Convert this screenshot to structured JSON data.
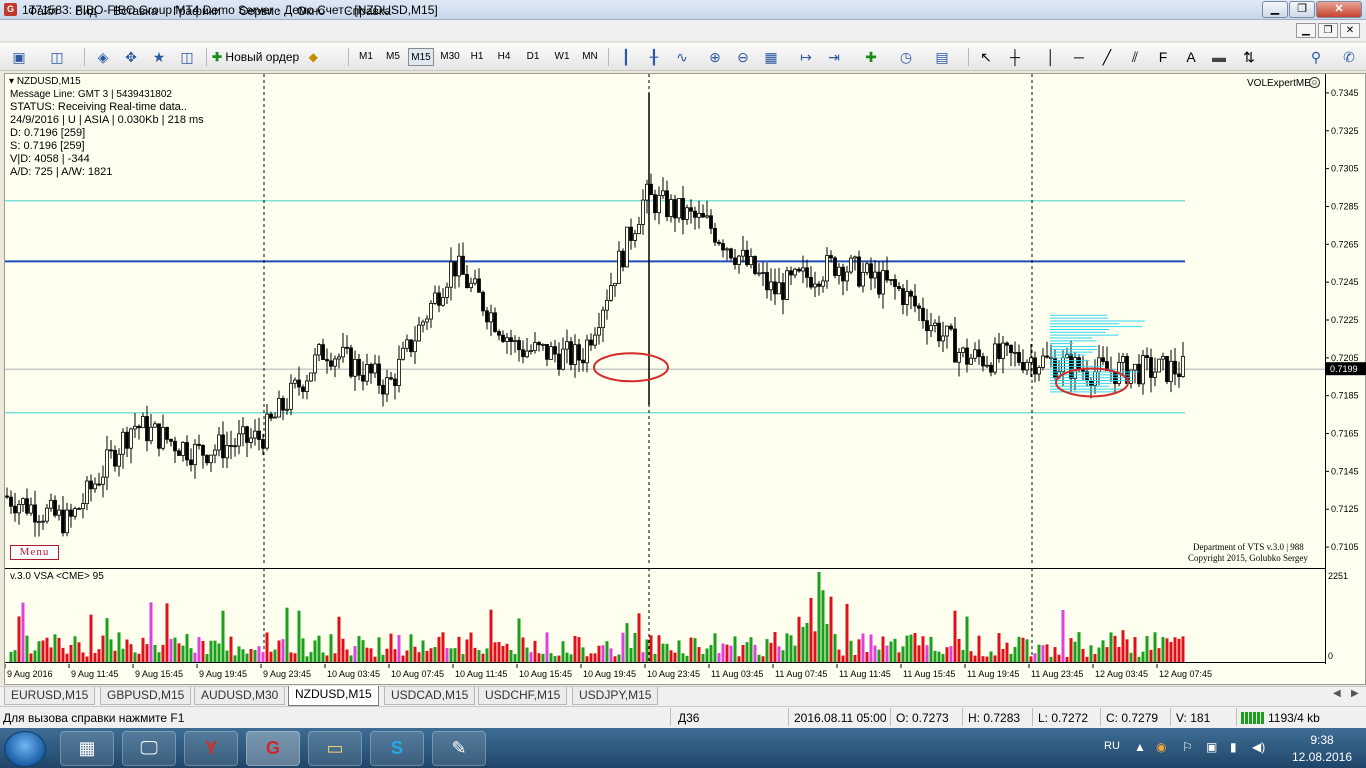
{
  "window": {
    "title": "1771583: FIBO-FIBO Group MT4 Demo Server - Демо Счет - [NZDUSD,M15]",
    "app_icon": "G",
    "min_glyph": "▁",
    "max_glyph": "❐",
    "close_glyph": "✕"
  },
  "menu": [
    "Файл",
    "Вид",
    "Вставка",
    "Графики",
    "Сервис",
    "Окно",
    "Справка"
  ],
  "mdi_controls": {
    "min": "▁",
    "restore": "❐",
    "close": "✕"
  },
  "toolbar": {
    "new_order_label": "Новый ордер",
    "timeframes": [
      "M1",
      "M5",
      "M15",
      "M30",
      "H1",
      "H4",
      "D1",
      "W1",
      "MN"
    ],
    "active_timeframe": "M15",
    "icons": {
      "new-chart": "▣",
      "profiles": "◫",
      "market-watch": "◈",
      "navigator": "✥",
      "favorites": "★",
      "expert": "◆",
      "bar-chart": "┃",
      "candle-chart": "╂",
      "line-chart": "∿",
      "zoom-in": "⊕",
      "zoom-out": "⊖",
      "tile": "▦",
      "autoscroll": "↦",
      "chart-shift": "⇥",
      "indicators": "✚",
      "periods": "◷",
      "templates": "▤",
      "cursor": "↖",
      "crosshair": "┼",
      "vline": "│",
      "hline": "─",
      "trendline": "╱",
      "channel": "⫽",
      "fibo": "F",
      "text": "A",
      "label": "▬",
      "arrows": "⇅",
      "search": "⚲",
      "community": "✆"
    }
  },
  "chart": {
    "symbol_label": "NZDUSD,M15",
    "info_lines": [
      "Message Line: GMT 3 | 5439431802",
      "STATUS:  Receiving Real-time data..",
      "24/9/2016 | U | ASIA | 0.030Kb | 218 ms",
      "D: 0.7196  [259]",
      "S: 0.7196  [259]",
      "V|D: 4058 | -344",
      "A/D: 725 | A/W: 1821"
    ],
    "menu_button": "Menu",
    "expert_label": "VOLExpertME",
    "expert_smile": "☺",
    "copyright_line1": "Department of VTS  v.3.0 | 988",
    "copyright_line2": "Copyright 2015, Golubko Sergey",
    "current_price": "0.7199",
    "price_levels": [
      "0.7345",
      "0.7325",
      "0.7305",
      "0.7285",
      "0.7265",
      "0.7245",
      "0.7225",
      "0.7205",
      "0.7185",
      "0.7165",
      "0.7145",
      "0.7125",
      "0.7105"
    ],
    "vsa_label": "v.3.0 VSA <CME> 95",
    "vol_max": "2251",
    "vol_zero": "0",
    "time_labels": [
      "9 Aug 2016",
      "9 Aug 11:45",
      "9 Aug 15:45",
      "9 Aug 19:45",
      "9 Aug 23:45",
      "10 Aug 03:45",
      "10 Aug 07:45",
      "10 Aug 11:45",
      "10 Aug 15:45",
      "10 Aug 19:45",
      "10 Aug 23:45",
      "11 Aug 03:45",
      "11 Aug 07:45",
      "11 Aug 11:45",
      "11 Aug 15:45",
      "11 Aug 19:45",
      "11 Aug 23:45",
      "12 Aug 03:45",
      "12 Aug 07:45"
    ],
    "colors": {
      "background": "#fffff0",
      "candle": "#000000",
      "resistance_line": "#1f4fbf",
      "level_line": "#7fe0d8",
      "circle": "#d42a2a",
      "volume_green": "#1aa01a",
      "volume_red": "#e0101a",
      "volume_magenta": "#e040e0",
      "profile": "#33d6f0"
    }
  },
  "chart_data": {
    "type": "candlestick",
    "symbol": "NZDUSD",
    "timeframe": "M15",
    "ylim": [
      0.7095,
      0.7355
    ],
    "horizontal_levels": [
      0.7288,
      0.7256,
      0.7199,
      0.7176
    ],
    "key_points": [
      {
        "t": "9 Aug 2016",
        "price": 0.7132
      },
      {
        "t": "9 Aug 11:45",
        "price": 0.7118
      },
      {
        "t": "9 Aug 15:45",
        "price": 0.717
      },
      {
        "t": "9 Aug 19:45",
        "price": 0.7155
      },
      {
        "t": "9 Aug 23:45",
        "price": 0.7163
      },
      {
        "t": "10 Aug 03:45",
        "price": 0.721
      },
      {
        "t": "10 Aug 07:45",
        "price": 0.719
      },
      {
        "t": "10 Aug 11:45",
        "price": 0.7255
      },
      {
        "t": "10 Aug 15:45",
        "price": 0.721
      },
      {
        "t": "10 Aug 19:45",
        "price": 0.7205
      },
      {
        "t": "10 Aug 23:45",
        "price": 0.729
      },
      {
        "t": "11 Aug 03:45",
        "price": 0.7275
      },
      {
        "t": "11 Aug 07:45",
        "price": 0.724
      },
      {
        "t": "11 Aug 11:45",
        "price": 0.7255
      },
      {
        "t": "11 Aug 15:45",
        "price": 0.724
      },
      {
        "t": "11 Aug 19:45",
        "price": 0.7205
      },
      {
        "t": "11 Aug 23:45",
        "price": 0.7205
      },
      {
        "t": "12 Aug 03:45",
        "price": 0.7198
      },
      {
        "t": "12 Aug 07:45",
        "price": 0.7199
      }
    ],
    "spike": {
      "t": "10 Aug 23:45",
      "high": 0.7345,
      "low": 0.718
    }
  },
  "tabs": [
    "EURUSD,M15",
    "GBPUSD,M15",
    "AUDUSD,M30",
    "NZDUSD,M15",
    "USDCAD,M15",
    "USDCHF,M15",
    "USDJPY,M15"
  ],
  "active_tab": "NZDUSD,M15",
  "tab_scroll": {
    "left": "◀",
    "right": "▶"
  },
  "status": {
    "help": "Для вызова справки нажмите F1",
    "profile": "Д36",
    "datetime": "2016.08.11 05:00",
    "open": "O: 0.7273",
    "high": "H: 0.7283",
    "low": "L: 0.7272",
    "close": "C: 0.7279",
    "volume": "V: 181",
    "traffic": "1193/4 kb"
  },
  "taskbar": {
    "apps": [
      {
        "name": "calculator",
        "glyph": "▦"
      },
      {
        "name": "computer",
        "glyph": "🖵"
      },
      {
        "name": "yandex",
        "glyph": "Y"
      },
      {
        "name": "fibo-terminal",
        "glyph": "G"
      },
      {
        "name": "explorer",
        "glyph": "▭"
      },
      {
        "name": "skype",
        "glyph": "S"
      },
      {
        "name": "notepad",
        "glyph": "✎"
      }
    ],
    "lang": "RU",
    "tray_icons": [
      "▲",
      "◉",
      "⚐",
      "▣",
      "▮",
      "◀)"
    ],
    "time": "9:38",
    "date": "12.08.2016"
  }
}
